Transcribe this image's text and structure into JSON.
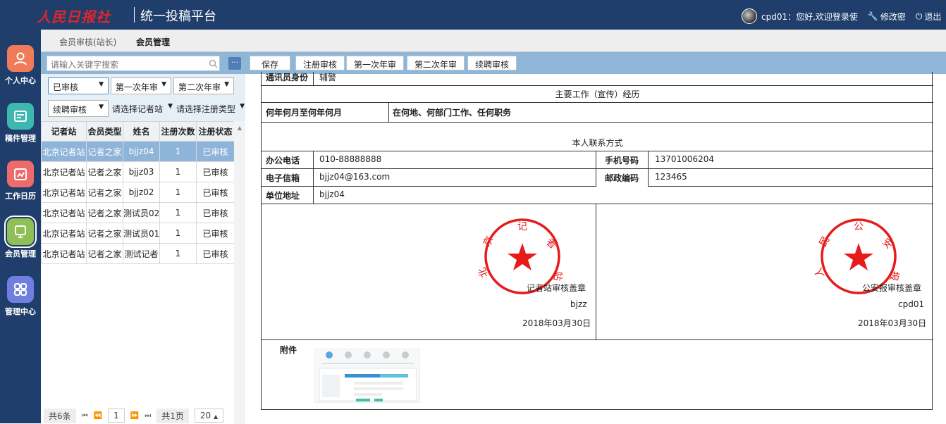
{
  "header": {
    "logo_text": "人民日报社",
    "platform_title": "统一投稿平台",
    "user_greeting": "cpd01：您好,欢迎登录使",
    "change_password": "修改密",
    "logout": "退出"
  },
  "nav": [
    {
      "label": "个人中心",
      "color": "#f07b5a"
    },
    {
      "label": "稿件管理",
      "color": "#3db7b0"
    },
    {
      "label": "工作日历",
      "color": "#ee6b6b"
    },
    {
      "label": "会员管理",
      "color": "#8fbf56"
    },
    {
      "label": "管理中心",
      "color": "#6f7fe0"
    }
  ],
  "tabs": [
    {
      "label": "会员审核(站长)"
    },
    {
      "label": "会员管理"
    }
  ],
  "search": {
    "placeholder": "请输入关键字搜索"
  },
  "filters": {
    "status": "已审核",
    "first_review": "第一次年审",
    "second_review": "第二次年审",
    "renew_review": "续聘审核",
    "station": "请选择记者站",
    "reg_type": "请选择注册类型"
  },
  "grid": {
    "headers": [
      "记者站",
      "会员类型",
      "姓名",
      "注册次数",
      "注册状态"
    ],
    "rows": [
      [
        "北京记者站",
        "记者之家",
        "bjjz04",
        "1",
        "已审核"
      ],
      [
        "北京记者站",
        "记者之家",
        "bjjz03",
        "1",
        "已审核"
      ],
      [
        "北京记者站",
        "记者之家",
        "bjjz02",
        "1",
        "已审核"
      ],
      [
        "北京记者站",
        "记者之家",
        "测试员02",
        "1",
        "已审核"
      ],
      [
        "北京记者站",
        "记者之家",
        "测试员01",
        "1",
        "已审核"
      ],
      [
        "北京记者站",
        "记者之家",
        "测试记者",
        "1",
        "已审核"
      ]
    ]
  },
  "pager": {
    "total": "共6条",
    "page": "1",
    "pages": "共1页",
    "size": "20"
  },
  "toolbar": {
    "save": "保存",
    "register_review": "注册审核",
    "first_review": "第一次年审",
    "second_review": "第二次年审",
    "renew_review": "续聘审核"
  },
  "form": {
    "identity_label": "通讯员身份",
    "identity_value": "辅警",
    "work_title": "主要工作（宣传）经历",
    "period_header": "何年何月至何年何月",
    "place_header": "在何地、何部门工作、任何职务",
    "contact_title": "本人联系方式",
    "office_phone_label": "办公电话",
    "office_phone": "010-88888888",
    "mobile_label": "手机号码",
    "mobile": "13701006204",
    "email_label": "电子信箱",
    "email": "bjjz04@163.com",
    "zip_label": "邮政编码",
    "zip": "123465",
    "address_label": "单位地址",
    "address": "bjjz04",
    "seal1": {
      "ring_text": "北京记者站",
      "caption": "记者站审核盖章",
      "signer": "bjzz",
      "date": "2018年03月30日"
    },
    "seal2": {
      "ring_text": "人民公安报",
      "caption": "公安报审核盖章",
      "signer": "cpd01",
      "date": "2018年03月30日"
    },
    "attachment_label": "附件"
  }
}
